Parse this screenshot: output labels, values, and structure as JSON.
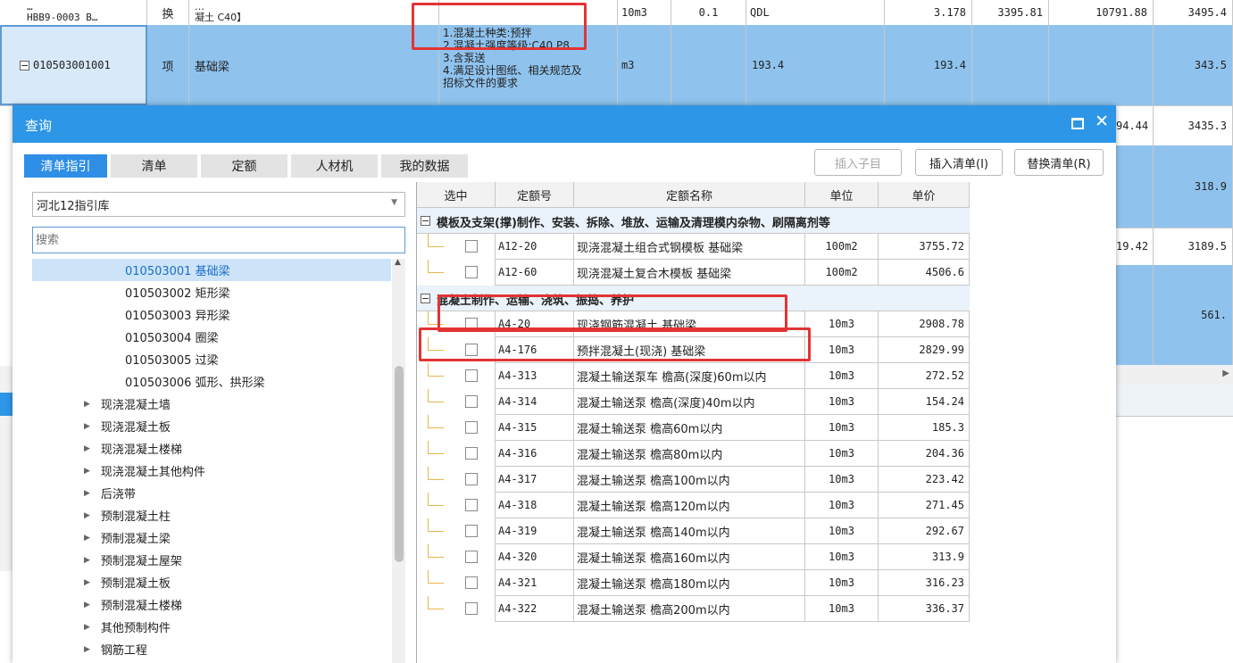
{
  "background": {
    "row0": {
      "code_line1": "…",
      "code_line2": "HBB9-0003 B…",
      "type": "换",
      "name_line1": "…",
      "name_line2": "凝土 C40】",
      "unit": "10m3",
      "qty": "0.1",
      "expr": "QDL",
      "v1": "3.178",
      "v2": "3395.81",
      "v3": "10791.88",
      "v4": "3495.4"
    },
    "row1": {
      "code": "010503001001",
      "type": "项",
      "name": "基础梁",
      "features": [
        "1.混凝土种类:预拌",
        "2.混凝土强度等级:C40 P8",
        "3.含泵送",
        "4.满足设计图纸、相关规范及",
        "招标文件的要求"
      ],
      "unit": "m3",
      "qty": "193.4",
      "qty2": "193.4",
      "v4": "343.5"
    },
    "right_values": [
      {
        "a": "94.44",
        "b": "3435.3"
      },
      {
        "a": "",
        "b": "318.9"
      },
      {
        "a": "19.42",
        "b": "3189.5"
      },
      {
        "a": "",
        "b": "561."
      }
    ]
  },
  "dialog": {
    "title": "查询",
    "tabs": [
      "清单指引",
      "清单",
      "定额",
      "人材机",
      "我的数据"
    ],
    "buttons": {
      "insert_child": "插入子目",
      "insert_list": "插入清单(I)",
      "replace_list": "替换清单(R)"
    },
    "library_select": "河北12指引库",
    "search_placeholder": "搜索",
    "tree": [
      {
        "label": "010503001  基础梁",
        "level": 2,
        "selected": true
      },
      {
        "label": "010503002  矩形梁",
        "level": 2
      },
      {
        "label": "010503003  异形梁",
        "level": 2
      },
      {
        "label": "010503004  圈梁",
        "level": 2
      },
      {
        "label": "010503005  过梁",
        "level": 2
      },
      {
        "label": "010503006  弧形、拱形梁",
        "level": 2
      },
      {
        "label": "现浇混凝土墙",
        "level": 1
      },
      {
        "label": "现浇混凝土板",
        "level": 1
      },
      {
        "label": "现浇混凝土楼梯",
        "level": 1
      },
      {
        "label": "现浇混凝土其他构件",
        "level": 1
      },
      {
        "label": "后浇带",
        "level": 1
      },
      {
        "label": "预制混凝土柱",
        "level": 1
      },
      {
        "label": "预制混凝土梁",
        "level": 1
      },
      {
        "label": "预制混凝土屋架",
        "level": 1
      },
      {
        "label": "预制混凝土板",
        "level": 1
      },
      {
        "label": "预制混凝土楼梯",
        "level": 1
      },
      {
        "label": "其他预制构件",
        "level": 1
      },
      {
        "label": "钢筋工程",
        "level": 1
      }
    ],
    "grid": {
      "headers": [
        "选中",
        "定额号",
        "定额名称",
        "单位",
        "单价"
      ],
      "groups": [
        {
          "title": "模板及支架(撑)制作、安装、拆除、堆放、运输及清理模内杂物、刷隔离剂等",
          "rows": [
            {
              "code": "A12-20",
              "name": "现浇混凝土组合式钢模板 基础梁",
              "unit": "100m2",
              "price": "3755.72"
            },
            {
              "code": "A12-60",
              "name": "现浇混凝土复合木模板 基础梁",
              "unit": "100m2",
              "price": "4506.6"
            }
          ]
        },
        {
          "title": "混凝土制作、运输、浇筑、振捣、养护",
          "rows": [
            {
              "code": "A4-20",
              "name": "现浇钢筋混凝土 基础梁",
              "unit": "10m3",
              "price": "2908.78"
            },
            {
              "code": "A4-176",
              "name": "预拌混凝土(现浇) 基础梁",
              "unit": "10m3",
              "price": "2829.99"
            },
            {
              "code": "A4-313",
              "name": "混凝土输送泵车 檐高(深度)60m以内",
              "unit": "10m3",
              "price": "272.52"
            },
            {
              "code": "A4-314",
              "name": "混凝土输送泵 檐高(深度)40m以内",
              "unit": "10m3",
              "price": "154.24"
            },
            {
              "code": "A4-315",
              "name": "混凝土输送泵 檐高60m以内",
              "unit": "10m3",
              "price": "185.3"
            },
            {
              "code": "A4-316",
              "name": "混凝土输送泵 檐高80m以内",
              "unit": "10m3",
              "price": "204.36"
            },
            {
              "code": "A4-317",
              "name": "混凝土输送泵 檐高100m以内",
              "unit": "10m3",
              "price": "223.42"
            },
            {
              "code": "A4-318",
              "name": "混凝土输送泵 檐高120m以内",
              "unit": "10m3",
              "price": "271.45"
            },
            {
              "code": "A4-319",
              "name": "混凝土输送泵 檐高140m以内",
              "unit": "10m3",
              "price": "292.67"
            },
            {
              "code": "A4-320",
              "name": "混凝土输送泵 檐高160m以内",
              "unit": "10m3",
              "price": "313.9"
            },
            {
              "code": "A4-321",
              "name": "混凝土输送泵 檐高180m以内",
              "unit": "10m3",
              "price": "316.23"
            },
            {
              "code": "A4-322",
              "name": "混凝土输送泵 檐高200m以内",
              "unit": "10m3",
              "price": "336.37"
            }
          ]
        }
      ]
    }
  },
  "colors": {
    "title_bar": "#2e96e6",
    "selected_row": "#8fc3ee",
    "annotation_red": "#e23434"
  },
  "icons": [
    "restore-icon",
    "close-icon",
    "dropdown-arrow-icon",
    "expand-arrow-icon",
    "collapse-box-icon"
  ]
}
